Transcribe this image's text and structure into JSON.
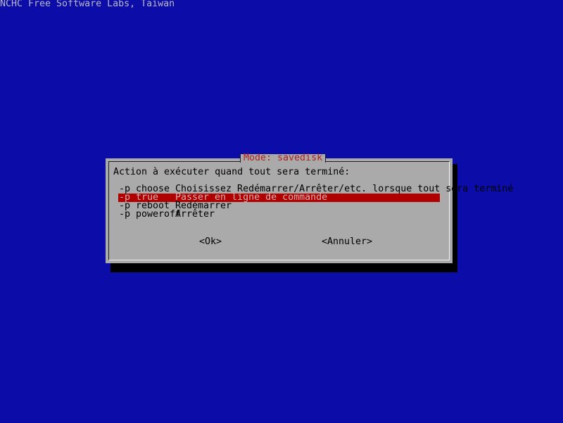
{
  "backtitle": "NCHC Free Software Labs, Taiwan",
  "dialog": {
    "title": "Mode: savedisk",
    "prompt": "Action à exécuter quand tout sera terminé:",
    "options": [
      {
        "key": "-p choose",
        "desc": "Choisissez Redémarrer/Arrêter/etc. lorsque tout sera terminé",
        "selected": false
      },
      {
        "key": "-p true",
        "desc": "Passer en ligne de commande",
        "selected": true
      },
      {
        "key": "-p reboot",
        "desc": "Redémarrer",
        "selected": false
      },
      {
        "key": "-p poweroff",
        "desc": "Arrêter",
        "selected": false
      }
    ],
    "ok_label": "<Ok>",
    "cancel_label": "<Annuler>"
  }
}
